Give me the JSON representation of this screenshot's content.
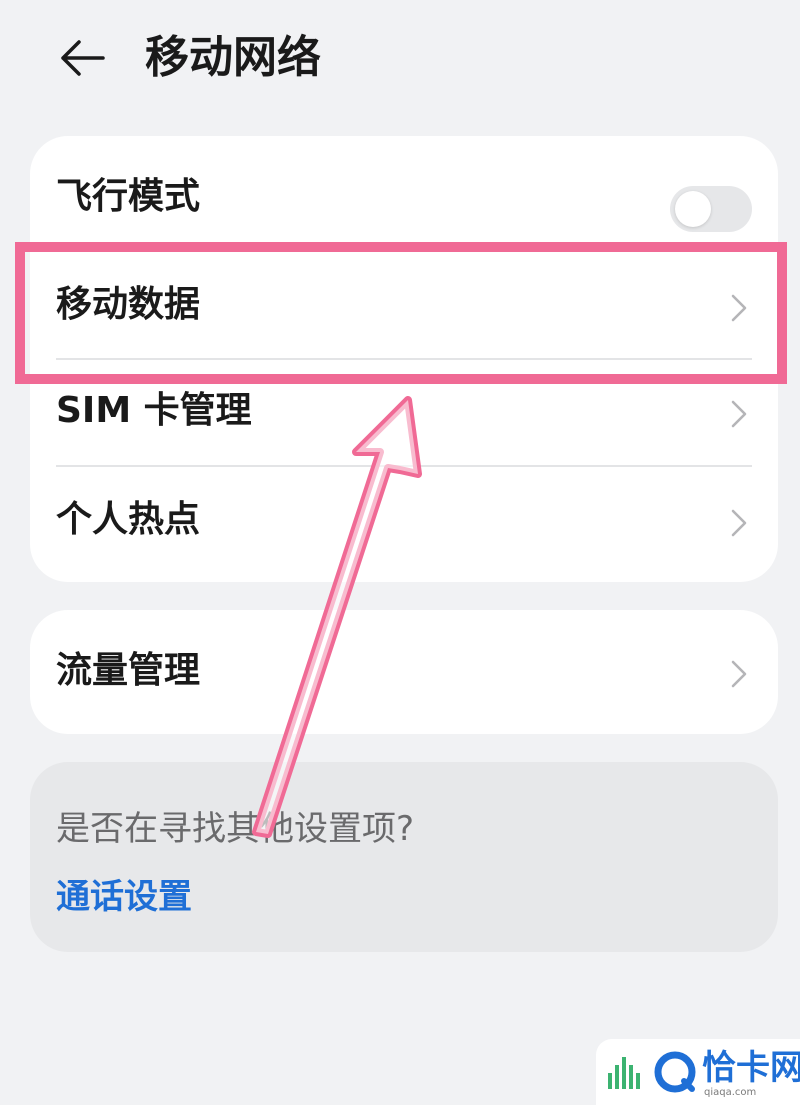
{
  "header": {
    "title": "移动网络",
    "back_icon": "back-arrow-icon"
  },
  "network_card": {
    "items": [
      {
        "label": "飞行模式",
        "control": "toggle",
        "toggle_on": false
      },
      {
        "label": "移动数据",
        "control": "chevron",
        "highlighted": true
      },
      {
        "label": "SIM 卡管理",
        "control": "chevron"
      },
      {
        "label": "个人热点",
        "control": "chevron"
      }
    ]
  },
  "traffic_card": {
    "label": "流量管理",
    "control": "chevron"
  },
  "hint_card": {
    "question": "是否在寻找其他设置项?",
    "link": "通话设置"
  },
  "annotation": {
    "highlight_color": "#f06a95",
    "arrow_color": "#f06a95"
  },
  "watermark": {
    "brand": "恰卡网",
    "domain": "qiaqa.com",
    "color": "#1f6fd6"
  },
  "colors": {
    "background": "#f1f2f4",
    "card": "#ffffff",
    "hint_card": "#e7e8ea",
    "link": "#1f6fd6",
    "text": "#1a1a1a",
    "chevron": "#b5b5b8"
  }
}
